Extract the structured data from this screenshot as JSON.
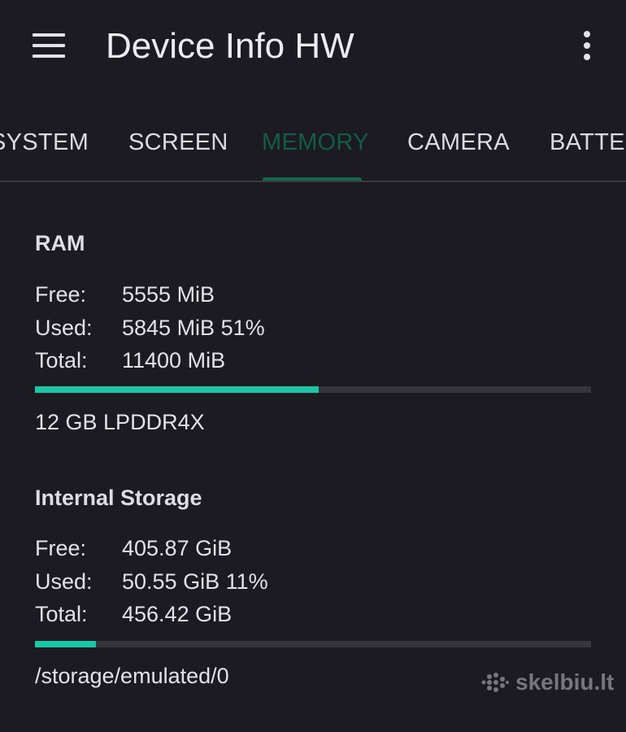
{
  "app": {
    "title": "Device Info HW",
    "menu_icon": "hamburger-menu-icon",
    "overflow_icon": "more-vert-icon"
  },
  "tabs": [
    {
      "label": "SYSTEM",
      "active": false
    },
    {
      "label": "SCREEN",
      "active": false
    },
    {
      "label": "MEMORY",
      "active": true
    },
    {
      "label": "CAMERA",
      "active": false
    },
    {
      "label": "BATTE",
      "active": false
    }
  ],
  "ram": {
    "title": "RAM",
    "free_label": "Free:",
    "free_value": "5555 MiB",
    "used_label": "Used:",
    "used_value": "5845 MiB 51%",
    "total_label": "Total:",
    "total_value": "11400 MiB",
    "usage_fraction": 0.51,
    "type": "12 GB LPDDR4X"
  },
  "storage": {
    "title": "Internal Storage",
    "free_label": "Free:",
    "free_value": "405.87 GiB",
    "used_label": "Used:",
    "used_value": "50.55 GiB 11%",
    "total_label": "Total:",
    "total_value": "456.42 GiB",
    "usage_fraction": 0.11,
    "path": "/storage/emulated/0"
  },
  "watermark": {
    "text": "skelbiu.lt"
  },
  "colors": {
    "background": "#1c1b21",
    "accent": "#1cc6a6",
    "active_tab": "#135c45",
    "bar_track": "#36353c"
  }
}
